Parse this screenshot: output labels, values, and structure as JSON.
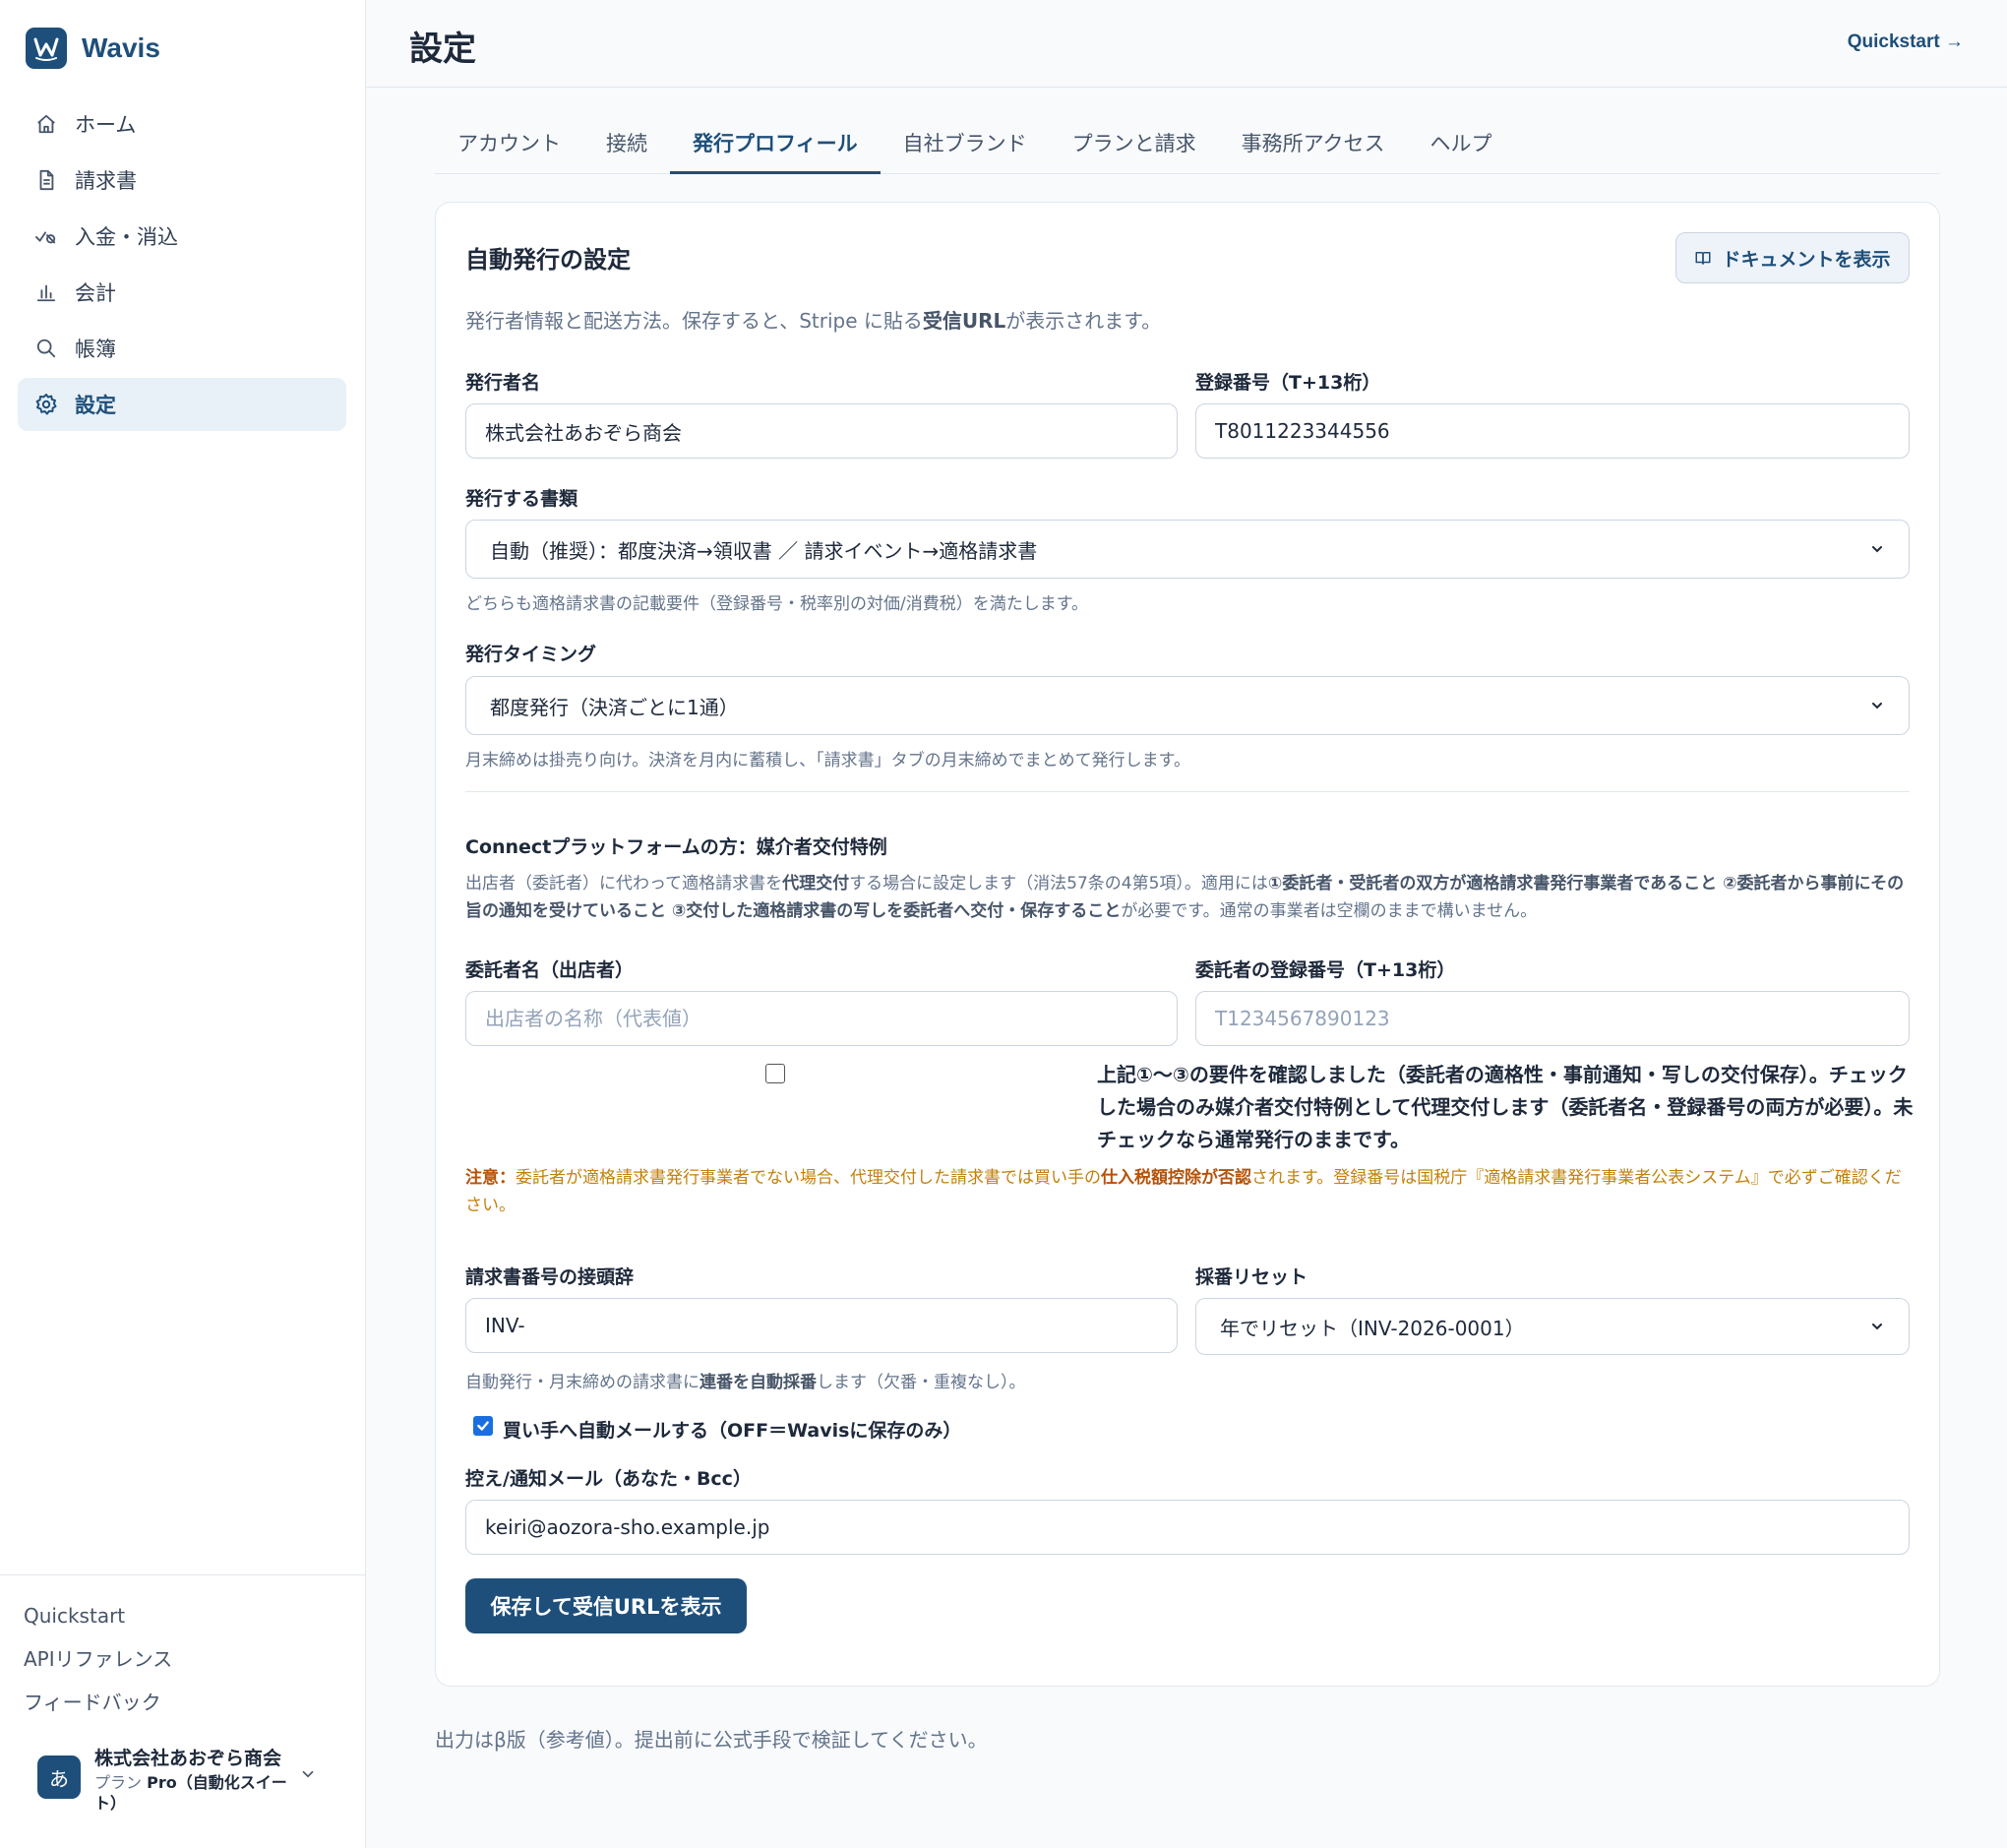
{
  "app": {
    "name": "Wavis",
    "logo_letter": "W"
  },
  "sidebar": {
    "items": [
      {
        "label": "ホーム",
        "icon": "home-icon"
      },
      {
        "label": "請求書",
        "icon": "document-icon"
      },
      {
        "label": "入金・消込",
        "icon": "check-flow-icon"
      },
      {
        "label": "会計",
        "icon": "bar-chart-icon"
      },
      {
        "label": "帳簿",
        "icon": "search-icon"
      },
      {
        "label": "設定",
        "icon": "gear-icon",
        "active": true
      }
    ],
    "links": [
      "Quickstart",
      "APIリファレンス",
      "フィードバック"
    ],
    "account": {
      "avatar": "あ",
      "name": "株式会社あおぞら商会",
      "plan_prefix": "プラン",
      "plan": "Pro（自動化スイート）"
    }
  },
  "header": {
    "title": "設定",
    "quickstart": "Quickstart →"
  },
  "tabs": [
    "アカウント",
    "接続",
    "発行プロフィール",
    "自社ブランド",
    "プランと請求",
    "事務所アクセス",
    "ヘルプ"
  ],
  "card": {
    "title": "自動発行の設定",
    "doc_button": "ドキュメントを表示",
    "desc_pre": "発行者情報と配送方法。保存すると、Stripe に貼る",
    "desc_bold": "受信URL",
    "desc_post": "が表示されます。",
    "issuer_label": "発行者名",
    "issuer_value": "株式会社あおぞら商会",
    "reg_label": "登録番号（T+13桁）",
    "reg_value": "T8011223344556",
    "doctype_label": "発行する書類",
    "doctype_value": "自動（推奨）：都度決済→領収書 ／ 請求イベント→適格請求書",
    "doctype_hint": "どちらも適格請求書の記載要件（登録番号・税率別の対価/消費税）を満たします。",
    "timing_label": "発行タイミング",
    "timing_value": "都度発行（決済ごとに1通）",
    "timing_hint": "月末締めは掛売り向け。決済を月内に蓄積し、「請求書」タブの月末締めでまとめて発行します。",
    "connect_title": "Connectプラットフォームの方：媒介者交付特例",
    "connect_desc_1": "出店者（委託者）に代わって適格請求書を",
    "connect_desc_b1": "代理交付",
    "connect_desc_2": "する場合に設定します（消法57条の4第5項）。適用には",
    "connect_desc_b2": "①委託者・受託者の双方が適格請求書発行事業者であること ②委託者から事前にその旨の通知を受けていること ③交付した適格請求書の写しを委託者へ交付・保存すること",
    "connect_desc_3": "が必要です。通常の事業者は空欄のままで構いません。",
    "consignor_label": "委託者名（出店者）",
    "consignor_placeholder": "出店者の名称（代表値）",
    "consignor_reg_label": "委託者の登録番号（T+13桁）",
    "consignor_reg_placeholder": "T1234567890123",
    "confirm_text": "上記①〜③の要件を確認しました（委託者の適格性・事前通知・写しの交付保存）。チェックした場合のみ媒介者交付特例として代理交付します（委託者名・登録番号の両方が必要）。未チェックなら通常発行のままです。",
    "warn_label": "注意：",
    "warn_1": "委託者が適格請求書発行事業者でない場合、代理交付した請求書では買い手の",
    "warn_b": "仕入税額控除が否認",
    "warn_2": "されます。登録番号は国税庁『適格請求書発行事業者公表システム』で必ずご確認ください。",
    "prefix_label": "請求書番号の接頭辞",
    "prefix_value": "INV-",
    "reset_label": "採番リセット",
    "reset_value": "年でリセット（INV-2026-0001）",
    "numbering_hint_pre": "自動発行・月末締めの請求書に",
    "numbering_hint_b": "連番を自動採番",
    "numbering_hint_post": "します（欠番・重複なし）。",
    "auto_mail_label": "買い手へ自動メールする（OFF＝Wavisに保存のみ）",
    "notify_label": "控え/通知メール（あなた・Bcc）",
    "notify_value": "keiri@aozora-sho.example.jp",
    "save_button": "保存して受信URLを表示"
  },
  "footer_note": "出力はβ版（参考値）。提出前に公式手段で検証してください。",
  "colors": {
    "brand": "#1e4f7a",
    "active_bg": "#e8f0f8",
    "warning": "#c2810c",
    "checkbox": "#1a6fe0"
  }
}
